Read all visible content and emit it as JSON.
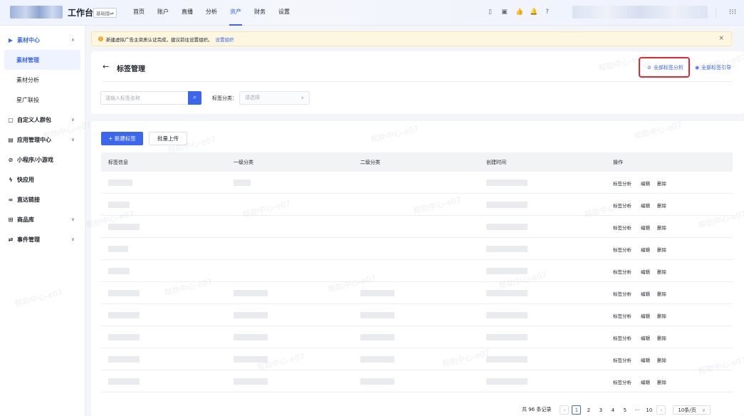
{
  "topbar": {
    "title": "工作台",
    "version_badge": "基础版⇌",
    "nav": [
      "首页",
      "账户",
      "直播",
      "分析",
      "资产",
      "财务",
      "设置"
    ],
    "active_nav": "资产",
    "icons": [
      "phone-icon",
      "briefcase-icon",
      "thumb-icon",
      "bell-icon",
      "help-icon",
      "apps-grid-icon"
    ]
  },
  "sidebar": {
    "groups": [
      {
        "icon": "media-icon",
        "label": "素材中心",
        "open": true,
        "sub": [
          "素材管理",
          "素材分析",
          "星广联投"
        ],
        "active_sub": "素材管理"
      },
      {
        "icon": "audience-icon",
        "label": "自定义人群包"
      },
      {
        "icon": "app-icon",
        "label": "应用管理中心"
      },
      {
        "icon": "miniprogram-icon",
        "label": "小程序/小游戏"
      },
      {
        "icon": "quickapp-icon",
        "label": "快应用"
      },
      {
        "icon": "link-icon",
        "label": "直达链接"
      },
      {
        "icon": "product-icon",
        "label": "商品库"
      },
      {
        "icon": "event-icon",
        "label": "事件管理"
      }
    ]
  },
  "notice": {
    "text": "新建虚拟广告主资质认证完成，建议前往设置组织。",
    "link": "设置组织"
  },
  "header": {
    "title": "标签管理",
    "all_tag_analysis": "全部标签分析",
    "all_tag_guide": "全部标签引导",
    "search_placeholder": "请输入标签名称",
    "category_label": "标签分类：",
    "category_placeholder": "请选择"
  },
  "toolbar": {
    "new_tag": "+ 新建标签",
    "batch_upload": "批量上传"
  },
  "table": {
    "columns": [
      "标签信息",
      "一级分类",
      "二级分类",
      "创建时间",
      "操作"
    ],
    "row_actions": [
      "标签分析",
      "编辑",
      "删除"
    ],
    "row_count": 10
  },
  "pagination": {
    "total_text": "共 96 条记录",
    "pages": [
      "1",
      "2",
      "3",
      "4",
      "5",
      "···",
      "10"
    ],
    "current": "1",
    "page_size": "10条/页"
  },
  "watermark": "帮助中心-e07"
}
